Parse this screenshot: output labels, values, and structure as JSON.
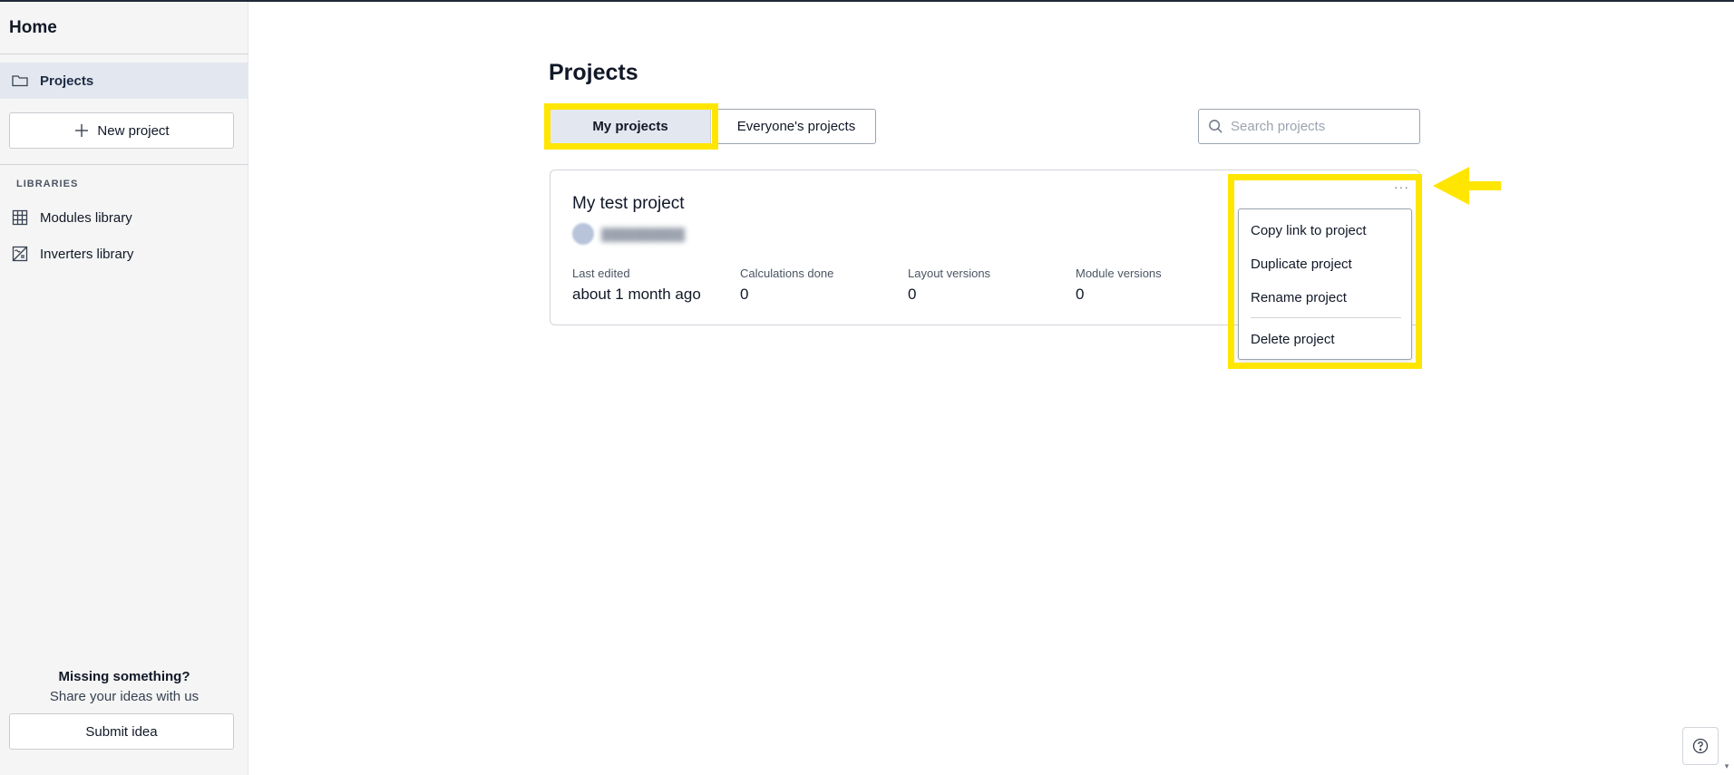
{
  "sidebar": {
    "title": "Home",
    "nav": [
      {
        "label": "Projects",
        "icon": "folder-icon",
        "active": true
      }
    ],
    "new_project_label": "New project",
    "section_label": "LIBRARIES",
    "libraries": [
      {
        "label": "Modules library",
        "icon": "grid-icon"
      },
      {
        "label": "Inverters library",
        "icon": "inverter-icon"
      }
    ],
    "footer": {
      "title": "Missing something?",
      "subtitle": "Share your ideas with us",
      "button_label": "Submit idea"
    }
  },
  "main": {
    "title": "Projects",
    "tabs": [
      {
        "label": "My projects",
        "active": true
      },
      {
        "label": "Everyone's projects",
        "active": false
      }
    ],
    "search": {
      "placeholder": "Search projects",
      "value": ""
    },
    "projects": [
      {
        "name": "My test project",
        "stats": [
          {
            "label": "Last edited",
            "value": "about 1 month ago"
          },
          {
            "label": "Calculations done",
            "value": "0"
          },
          {
            "label": "Layout versions",
            "value": "0"
          },
          {
            "label": "Module versions",
            "value": "0"
          }
        ],
        "menu_button": "···",
        "menu_items": [
          "Copy link to project",
          "Duplicate project",
          "Rename project",
          "Delete project"
        ]
      }
    ]
  },
  "colors": {
    "highlight": "#ffe600",
    "active_bg": "#e3e8f0",
    "sidebar_bg": "#f5f5f5"
  }
}
